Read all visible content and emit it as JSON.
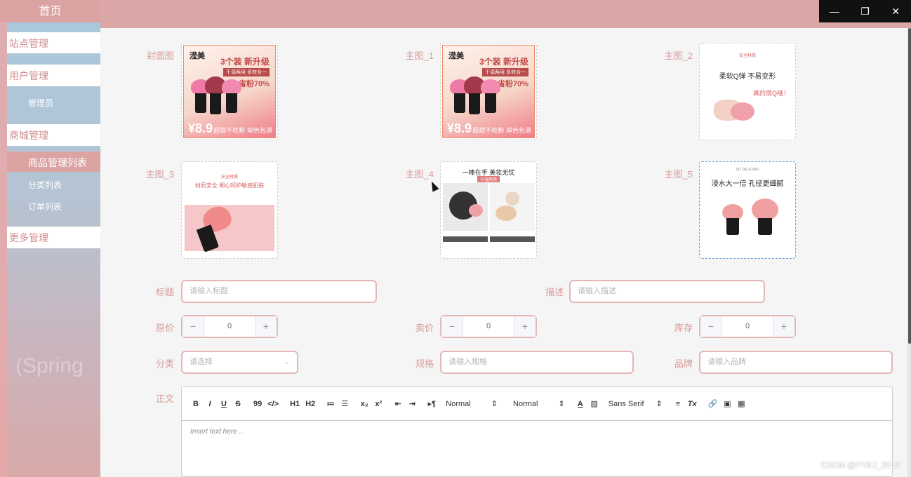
{
  "window": {
    "minimize": "—",
    "restore": "❐",
    "close": "✕"
  },
  "sidebar": {
    "home": "首页",
    "items": [
      {
        "label": "站点管理"
      },
      {
        "label": "用户管理"
      },
      {
        "label": "管理员"
      },
      {
        "label": "商城管理"
      },
      {
        "label": "商品管理列表"
      },
      {
        "label": "分类列表"
      },
      {
        "label": "订单列表"
      },
      {
        "label": "更多管理"
      }
    ],
    "bg_text": "(Spring"
  },
  "images": {
    "cover_label": "封面图",
    "main1_label": "主图_1",
    "main2_label": "主图_2",
    "main3_label": "主图_3",
    "main4_label": "主图_4",
    "main5_label": "主图_5",
    "art1": {
      "brand": "滢美",
      "headline": "3个装 新升级",
      "tag": "干湿两用 多效合一",
      "save": "省粉70%",
      "price": "¥8.9",
      "footer": "超软不吃粉 掉色包退"
    },
    "art2": {
      "sub": "安全材质",
      "title": "柔软Q弹 不易变形",
      "q": "真的很Q哦！"
    },
    "art3": {
      "sub": "安全材质",
      "title": "材质安全 细心呵护敏感肌肤"
    },
    "art4": {
      "title": "一棒在手 美妆无忧",
      "tag": "干湿两用"
    },
    "art6": {
      "brand": "SO DELICATE",
      "title": "浸水大一倍 孔径更细腻"
    }
  },
  "form": {
    "title_label": "标题",
    "title_placeholder": "请输入标题",
    "desc_label": "描述",
    "desc_placeholder": "请输入描述",
    "orig_price_label": "原价",
    "sale_price_label": "卖价",
    "stock_label": "库存",
    "orig_price_value": "0",
    "sale_price_value": "0",
    "stock_value": "0",
    "minus": "−",
    "plus": "+",
    "category_label": "分类",
    "category_placeholder": "请选择",
    "spec_label": "规格",
    "spec_placeholder": "请输入规格",
    "brand_label": "品牌",
    "brand_placeholder": "请输入品牌",
    "body_label": "正文"
  },
  "editor": {
    "bold": "B",
    "italic": "I",
    "underline": "U",
    "strike": "S",
    "quote": "99",
    "code": "</>",
    "h1": "H1",
    "h2": "H2",
    "ol": "≔",
    "ul": "☰",
    "sub": "x₂",
    "sup": "x²",
    "outdent": "⇤",
    "indent": "⇥",
    "rtl": "▸¶",
    "size": "Normal",
    "header": "Normal",
    "color": "A",
    "background": "▧",
    "font": "Sans Serif",
    "align": "≡",
    "clean": "Tx",
    "link": "🔗",
    "image": "▣",
    "video": "▦",
    "placeholder": "Insert text here ..."
  },
  "watermark": "CSDN @FYKJ_2010"
}
